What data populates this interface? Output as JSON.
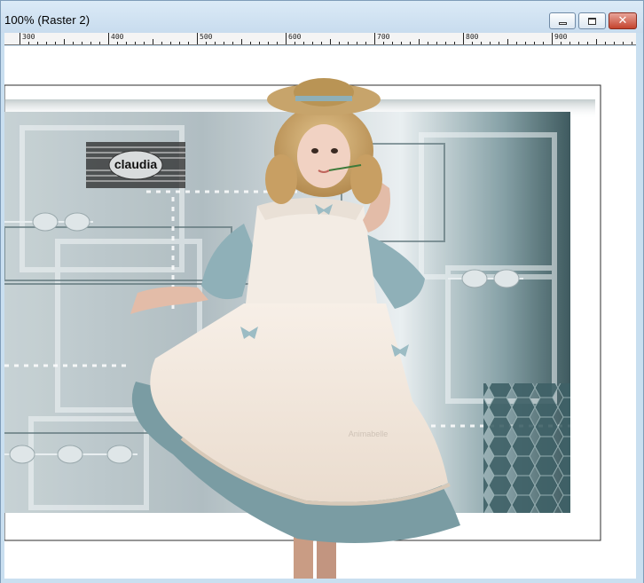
{
  "window": {
    "title": "100% (Raster 2)",
    "controls": {
      "minimize": "minimize",
      "maximize": "maximize",
      "close": "close"
    }
  },
  "ruler": {
    "labels": [
      "300",
      "400",
      "500",
      "600",
      "700",
      "800",
      "900"
    ]
  },
  "artwork": {
    "logo_text": "claudia",
    "watermark_text": "Animabelle"
  },
  "colors": {
    "frame": "#c9dff0",
    "close_button": "#c4432d",
    "background_teal": "#3c5e63"
  }
}
